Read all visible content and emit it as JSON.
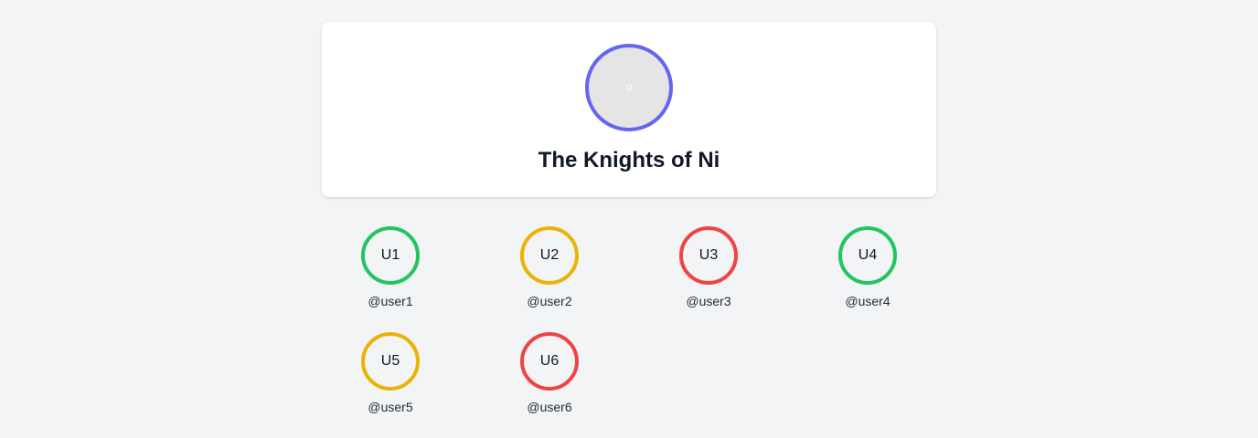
{
  "group": {
    "title": "The Knights of Ni",
    "avatar_border_color": "#6366f1"
  },
  "members": [
    {
      "initials": "U1",
      "handle": "@user1",
      "status_color": "#22c55e"
    },
    {
      "initials": "U2",
      "handle": "@user2",
      "status_color": "#eab308"
    },
    {
      "initials": "U3",
      "handle": "@user3",
      "status_color": "#ef4444"
    },
    {
      "initials": "U4",
      "handle": "@user4",
      "status_color": "#22c55e"
    },
    {
      "initials": "U5",
      "handle": "@user5",
      "status_color": "#eab308"
    },
    {
      "initials": "U6",
      "handle": "@user6",
      "status_color": "#ef4444"
    }
  ]
}
